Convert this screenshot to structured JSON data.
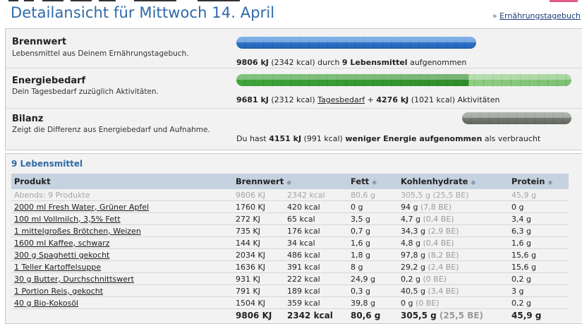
{
  "header": {
    "title": "Detailansicht für Mittwoch 14. April",
    "crumb_prefix": "»",
    "crumb_link": "Ernährungstagebuch"
  },
  "colors": {
    "title": "#2f6aa7",
    "blue_bar": "#2e72c8",
    "green_bar": "#3fa535",
    "grey_bar": "#7a7f78"
  },
  "summary": {
    "brennwert": {
      "title": "Brennwert",
      "subtitle": "Lebensmittel aus Deinem Ernährungstagebuch.",
      "kj": "9806 kJ",
      "kcal": "(2342 kcal)",
      "mid": "durch",
      "count": "9 Lebensmittel",
      "tail": "aufgenommen"
    },
    "energiebedarf": {
      "title": "Energiebedarf",
      "subtitle": "Dein Tagesbedarf zuzüglich Aktivitäten.",
      "kj": "9681 kJ",
      "kcal": "(2312 kcal)",
      "link": "Tagesbedarf",
      "plus": "+",
      "act_kj": "4276 kJ",
      "act_kcal": "(1021 kcal)",
      "tail": "Aktivitäten"
    },
    "bilanz": {
      "title": "Bilanz",
      "subtitle": "Zeigt die Differenz aus Energiebedarf und Aufnahme.",
      "pre": "Du hast",
      "kj": "4151 kJ",
      "kcal": "(991 kcal)",
      "bold": "weniger Energie aufgenommen",
      "tail": "als verbraucht"
    }
  },
  "table": {
    "count_label": "9 Lebensmittel",
    "headers": {
      "produkt": "Produkt",
      "brennwert": "Brennwert",
      "fett": "Fett",
      "kh": "Kohlenhydrate",
      "protein": "Protein"
    },
    "sort_icon": "◆",
    "group": {
      "name": "Abends: 9 Produkte",
      "kj": "9806 KJ",
      "kcal": "2342 kcal",
      "fett": "80,6 g",
      "kh": "305,5 g",
      "be": "(25,5 BE)",
      "protein": "45,9 g"
    },
    "rows": [
      {
        "name": "2000 ml Fresh Water, Grüner Apfel",
        "kj": "1760 KJ",
        "kcal": "420 kcal",
        "fett": "0 g",
        "kh": "94 g",
        "be": "(7,8 BE)",
        "protein": "0 g"
      },
      {
        "name": "100 ml Vollmilch, 3,5% Fett",
        "kj": "272 KJ",
        "kcal": "65 kcal",
        "fett": "3,5 g",
        "kh": "4,7 g",
        "be": "(0,4 BE)",
        "protein": "3,4 g"
      },
      {
        "name": "1 mittelgroßes Brötchen, Weizen",
        "kj": "735 KJ",
        "kcal": "176 kcal",
        "fett": "0,7 g",
        "kh": "34,3 g",
        "be": "(2,9 BE)",
        "protein": "6,3 g"
      },
      {
        "name": "1600 ml Kaffee, schwarz",
        "kj": "144 KJ",
        "kcal": "34 kcal",
        "fett": "1,6 g",
        "kh": "4,8 g",
        "be": "(0,4 BE)",
        "protein": "1,6 g"
      },
      {
        "name": "300 g Spaghetti gekocht",
        "kj": "2034 KJ",
        "kcal": "486 kcal",
        "fett": "1,8 g",
        "kh": "97,8 g",
        "be": "(8,2 BE)",
        "protein": "15,6 g"
      },
      {
        "name": "1 Teller Kartoffelsuppe",
        "kj": "1636 KJ",
        "kcal": "391 kcal",
        "fett": "8 g",
        "kh": "29,2 g",
        "be": "(2,4 BE)",
        "protein": "15,6 g"
      },
      {
        "name": "30 g Butter, Durchschnittswert",
        "kj": "931 KJ",
        "kcal": "222 kcal",
        "fett": "24,9 g",
        "kh": "0,2 g",
        "be": "(0 BE)",
        "protein": "0,2 g"
      },
      {
        "name": "1 Portion Reis, gekocht",
        "kj": "791 KJ",
        "kcal": "189 kcal",
        "fett": "0,3 g",
        "kh": "40,5 g",
        "be": "(3,4 BE)",
        "protein": "3 g"
      },
      {
        "name": "40 g Bio-Kokosöl",
        "kj": "1504 KJ",
        "kcal": "359 kcal",
        "fett": "39,8 g",
        "kh": "0 g",
        "be": "(0 BE)",
        "protein": "0,2 g"
      }
    ],
    "total": {
      "kj": "9806 KJ",
      "kcal": "2342 kcal",
      "fett": "80,6 g",
      "kh": "305,5 g",
      "be": "(25,5 BE)",
      "protein": "45,9 g"
    }
  }
}
